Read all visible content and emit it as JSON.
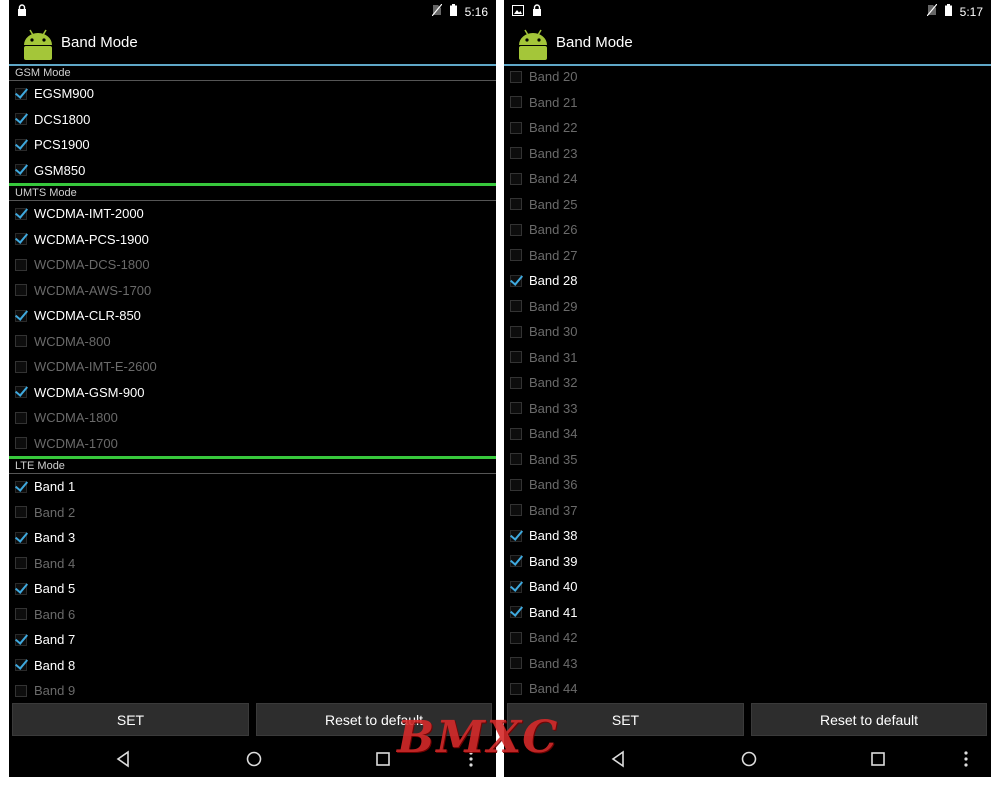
{
  "colors": {
    "accent": "#3fa9de",
    "divider": "#37c83c",
    "watermark": "#d42a2a"
  },
  "watermark": "BMXC",
  "left": {
    "time": "5:16",
    "title": "Band Mode",
    "sections": [
      {
        "header": "GSM Mode",
        "items": [
          {
            "label": "EGSM900",
            "checked": true
          },
          {
            "label": "DCS1800",
            "checked": true
          },
          {
            "label": "PCS1900",
            "checked": true
          },
          {
            "label": "GSM850",
            "checked": true
          }
        ]
      },
      {
        "header": "UMTS Mode",
        "items": [
          {
            "label": "WCDMA-IMT-2000",
            "checked": true
          },
          {
            "label": "WCDMA-PCS-1900",
            "checked": true
          },
          {
            "label": "WCDMA-DCS-1800",
            "checked": false
          },
          {
            "label": "WCDMA-AWS-1700",
            "checked": false
          },
          {
            "label": "WCDMA-CLR-850",
            "checked": true
          },
          {
            "label": "WCDMA-800",
            "checked": false
          },
          {
            "label": "WCDMA-IMT-E-2600",
            "checked": false
          },
          {
            "label": "WCDMA-GSM-900",
            "checked": true
          },
          {
            "label": "WCDMA-1800",
            "checked": false
          },
          {
            "label": "WCDMA-1700",
            "checked": false
          }
        ]
      },
      {
        "header": "LTE Mode",
        "items": [
          {
            "label": "Band 1",
            "checked": true
          },
          {
            "label": "Band 2",
            "checked": false
          },
          {
            "label": "Band 3",
            "checked": true
          },
          {
            "label": "Band 4",
            "checked": false
          },
          {
            "label": "Band 5",
            "checked": true
          },
          {
            "label": "Band 6",
            "checked": false
          },
          {
            "label": "Band 7",
            "checked": true
          },
          {
            "label": "Band 8",
            "checked": true
          },
          {
            "label": "Band 9",
            "checked": false
          }
        ]
      }
    ],
    "set_label": "SET",
    "reset_label": "Reset to default"
  },
  "right": {
    "time": "5:17",
    "title": "Band Mode",
    "items": [
      {
        "label": "Band 20",
        "checked": false
      },
      {
        "label": "Band 21",
        "checked": false
      },
      {
        "label": "Band 22",
        "checked": false
      },
      {
        "label": "Band 23",
        "checked": false
      },
      {
        "label": "Band 24",
        "checked": false
      },
      {
        "label": "Band 25",
        "checked": false
      },
      {
        "label": "Band 26",
        "checked": false
      },
      {
        "label": "Band 27",
        "checked": false
      },
      {
        "label": "Band 28",
        "checked": true
      },
      {
        "label": "Band 29",
        "checked": false
      },
      {
        "label": "Band 30",
        "checked": false
      },
      {
        "label": "Band 31",
        "checked": false
      },
      {
        "label": "Band 32",
        "checked": false
      },
      {
        "label": "Band 33",
        "checked": false
      },
      {
        "label": "Band 34",
        "checked": false
      },
      {
        "label": "Band 35",
        "checked": false
      },
      {
        "label": "Band 36",
        "checked": false
      },
      {
        "label": "Band 37",
        "checked": false
      },
      {
        "label": "Band 38",
        "checked": true
      },
      {
        "label": "Band 39",
        "checked": true
      },
      {
        "label": "Band 40",
        "checked": true
      },
      {
        "label": "Band 41",
        "checked": true
      },
      {
        "label": "Band 42",
        "checked": false
      },
      {
        "label": "Band 43",
        "checked": false
      },
      {
        "label": "Band 44",
        "checked": false
      }
    ],
    "set_label": "SET",
    "reset_label": "Reset to default"
  }
}
